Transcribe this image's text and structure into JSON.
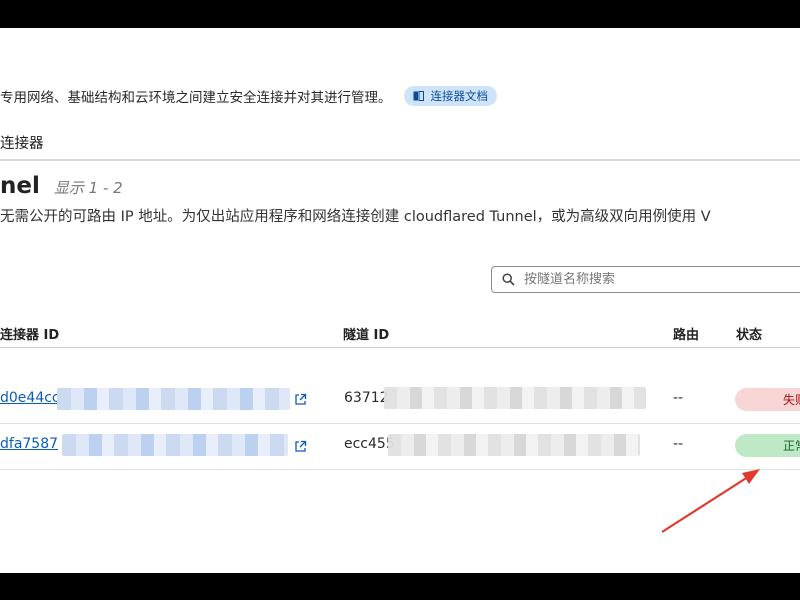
{
  "page": {
    "description": "专用网络、基础结构和云环境之间建立安全连接并对其进行管理。",
    "doc_badge": "连接器文档",
    "section_title": "连接器"
  },
  "tunnels": {
    "heading": "nel",
    "count": "显示 1 - 2",
    "description": "无需公开的可路由 IP 地址。为仅出站应用程序和网络连接创建 cloudflared Tunnel，或为高级双向用例使用 V",
    "search_placeholder": "按隧道名称搜索",
    "columns": {
      "connector_id": "连接器 ID",
      "tunnel_id": "隧道 ID",
      "route": "路由",
      "status": "状态"
    },
    "rows": [
      {
        "connector_id": "d0e44cc",
        "tunnel_id": "63712",
        "route": "--",
        "status": "失败",
        "status_color": "#f9d6d6"
      },
      {
        "connector_id": "dfa7587",
        "tunnel_id": "ecc455",
        "route": "--",
        "status": "正常",
        "status_color": "#bfe8c6"
      }
    ]
  },
  "colors": {
    "accent": "#0b5cba",
    "annotation_arrow": "#e03a2f"
  }
}
